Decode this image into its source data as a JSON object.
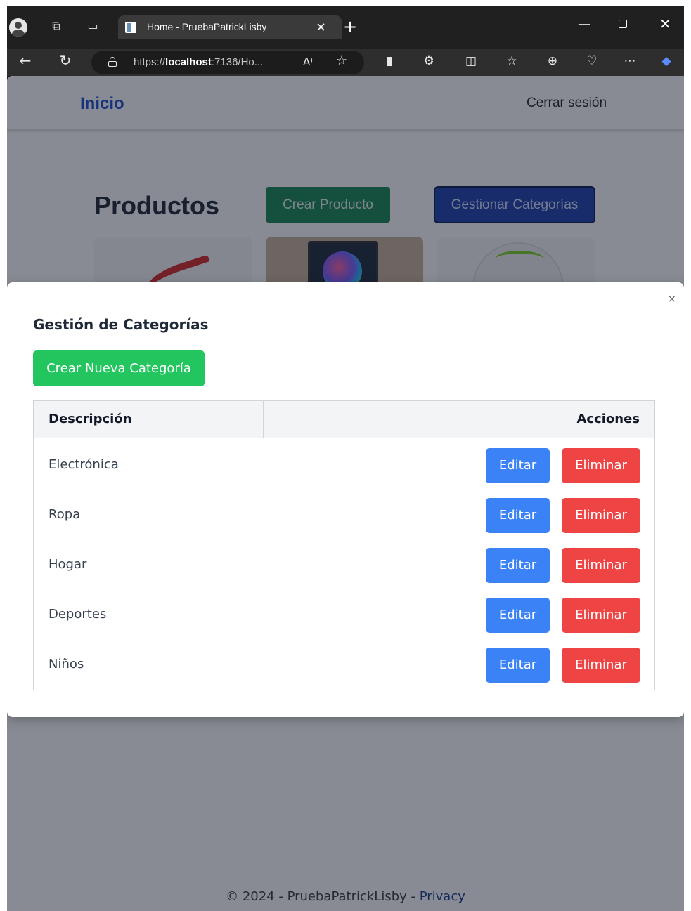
{
  "browser": {
    "tab_title": "Home - PruebaPatrickLisby",
    "url_prefix": "https://",
    "url_host": "localhost",
    "url_rest": ":7136/Ho...",
    "read_aloud_glyph": "A⁾"
  },
  "navbar": {
    "home_label": "Inicio",
    "logout_label": "Cerrar sesión"
  },
  "page": {
    "heading": "Productos",
    "create_product_label": "Crear Producto",
    "manage_categories_label": "Gestionar Categorías"
  },
  "modal": {
    "title": "Gestión de Categorías",
    "close_glyph": "×",
    "new_category_label": "Crear Nueva Categoría",
    "table": {
      "headers": [
        "Descripción",
        "Acciones"
      ],
      "rows": [
        {
          "description": "Electrónica",
          "edit_label": "Editar",
          "delete_label": "Eliminar"
        },
        {
          "description": "Ropa",
          "edit_label": "Editar",
          "delete_label": "Eliminar"
        },
        {
          "description": "Hogar",
          "edit_label": "Editar",
          "delete_label": "Eliminar"
        },
        {
          "description": "Deportes",
          "edit_label": "Editar",
          "delete_label": "Eliminar"
        },
        {
          "description": "Niños",
          "edit_label": "Editar",
          "delete_label": "Eliminar"
        }
      ]
    }
  },
  "footer": {
    "copyright": "© 2024 - PruebaPatrickLisby - ",
    "privacy_label": "Privacy"
  },
  "colors": {
    "primary_button": "#1e40af",
    "create_product_button": "#198754",
    "new_category_button": "#22c55e",
    "edit_button": "#3b82f6",
    "delete_button": "#ef4444",
    "brand_link": "#1f4fd1"
  }
}
